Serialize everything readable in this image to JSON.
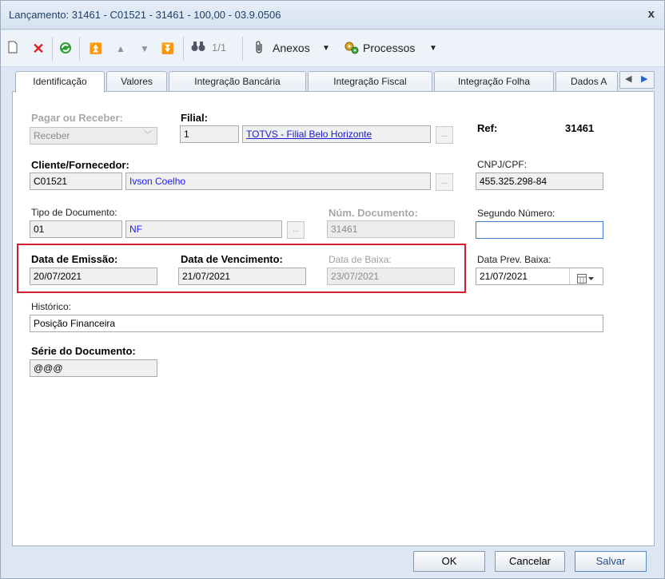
{
  "window": {
    "title": "Lançamento: 31461 - C01521 - 31461 - 100,00 - 03.9.0506",
    "close_glyph": "x"
  },
  "toolbar": {
    "position_text": "1/1",
    "attachments_label": "Anexos",
    "processes_label": "Processos"
  },
  "tabs": [
    {
      "label": "Identificação",
      "active": true
    },
    {
      "label": "Valores"
    },
    {
      "label": "Integração Bancária"
    },
    {
      "label": "Integração Fiscal"
    },
    {
      "label": "Integração Folha"
    },
    {
      "label": "Dados A"
    }
  ],
  "form": {
    "pay_receive_label": "Pagar ou Receber:",
    "pay_receive_value": "Receber",
    "branch_label": "Filial:",
    "branch_code": "1",
    "branch_name": "TOTVS - Filial Belo Horizonte",
    "ref_label": "Ref:",
    "ref_value": "31461",
    "client_label": "Cliente/Fornecedor:",
    "client_code": "C01521",
    "client_name": "Ivson Coelho",
    "cnpj_label": "CNPJ/CPF:",
    "cnpj_value": "455.325.298-84",
    "doc_type_label": "Tipo de Documento:",
    "doc_type_code": "01",
    "doc_type_name": "NF",
    "doc_number_label": "Núm. Documento:",
    "doc_number_value": "31461",
    "second_number_label": "Segundo Número:",
    "second_number_value": "",
    "issue_date_label": "Data de Emissão:",
    "issue_date_value": "20/07/2021",
    "due_date_label": "Data de Vencimento:",
    "due_date_value": "21/07/2021",
    "settle_date_label": "Data de Baixa:",
    "settle_date_value": "23/07/2021",
    "expected_settle_label": "Data Prev. Baixa:",
    "expected_settle_value": "21/07/2021",
    "history_label": "Histórico:",
    "history_value": "Posição Financeira",
    "series_label": "Série do Documento:",
    "series_value": "@@@",
    "ellipsis": "..."
  },
  "buttons": {
    "ok": "OK",
    "cancel": "Cancelar",
    "save": "Salvar"
  },
  "colors": {
    "highlight_box": "#d21f2b",
    "link": "#1a1acc"
  }
}
